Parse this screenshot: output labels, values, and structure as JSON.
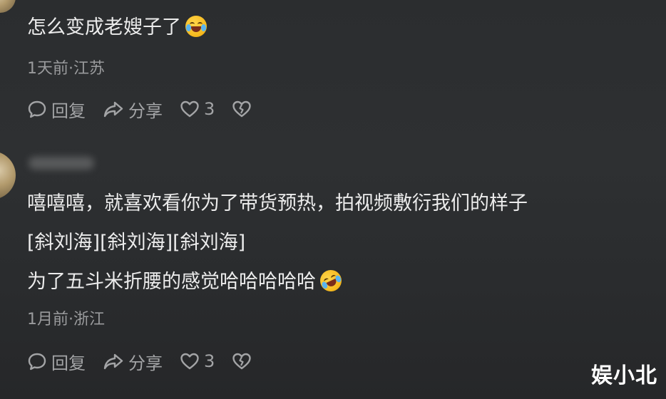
{
  "comment1": {
    "text": "怎么变成老嫂子了",
    "emoji": "laughing-crying-emoji",
    "meta": "1天前·江苏",
    "actions": {
      "reply": "回复",
      "share": "分享",
      "likes": "3"
    }
  },
  "comment2": {
    "line1": "嘻嘻嘻，就喜欢看你为了带货预热，拍视频敷衍我们的样子",
    "line2": "[斜刘海][斜刘海][斜刘海]",
    "line3": "为了五斗米折腰的感觉哈哈哈哈哈",
    "emoji": "rolling-laughing-emoji",
    "meta": "1月前·浙江",
    "actions": {
      "reply": "回复",
      "share": "分享",
      "likes": "3"
    }
  },
  "watermark": "娱小北",
  "colors": {
    "background": "#2c2e30",
    "text": "#ececec",
    "meta": "#9a9b9d",
    "icon": "#a3a4a6"
  }
}
